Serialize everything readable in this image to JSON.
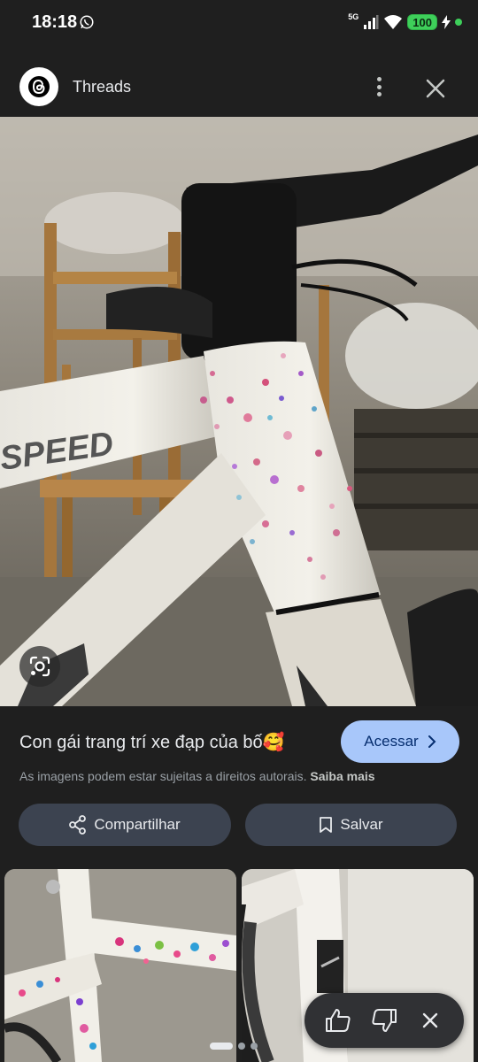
{
  "status_bar": {
    "time": "18:18",
    "network": "5G",
    "battery": "100"
  },
  "header": {
    "source_name": "Threads"
  },
  "image_info": {
    "title": "Con gái trang trí xe đạp của bố🥰",
    "visit_label": "Acessar",
    "copyright_notice": "As imagens podem estar sujeitas a direitos autorais.",
    "learn_more": "Saiba mais"
  },
  "actions": {
    "share_label": "Compartilhar",
    "save_label": "Salvar"
  },
  "main_image_text": "SPEED",
  "colors": {
    "background": "#1f1f1f",
    "accent_button": "#a8c7fa",
    "action_button": "#3c4350",
    "battery_green": "#3ecf5a"
  },
  "icons": [
    "whatsapp-icon",
    "signal-icon",
    "wifi-icon",
    "threads-logo-icon",
    "more-vert-icon",
    "close-icon",
    "google-lens-icon",
    "chevron-right-icon",
    "share-icon",
    "bookmark-icon",
    "thumbs-up-icon",
    "thumbs-down-icon",
    "dismiss-icon"
  ]
}
